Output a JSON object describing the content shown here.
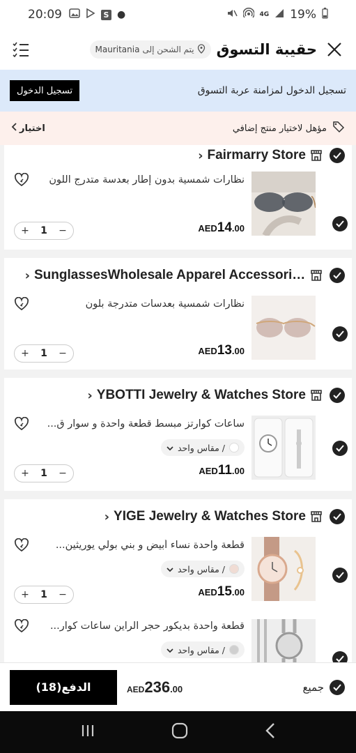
{
  "status_bar": {
    "time": "20:09",
    "battery": "19%",
    "s_box": "S",
    "network": "4G"
  },
  "header": {
    "title": "حقيبة التسوق",
    "ship_to_label": "يتم الشحن إلى",
    "country": "Mauritania"
  },
  "signin": {
    "text": "تسجيل الدخول لمزامنة عربة التسوق",
    "button": "تسجيل الدخول"
  },
  "promo": {
    "text": "مؤهل لاختيار منتج إضافي",
    "choose": "اختيار"
  },
  "stores": [
    {
      "name": "Fairmarry Store",
      "items": [
        {
          "title": "نظارات شمسية بدون إطار بعدسة متدرج اللون",
          "currency": "AED",
          "price_int": "14",
          "price_dec": ".00",
          "qty": "1",
          "variant": null
        }
      ]
    },
    {
      "name": "SunglassesWholesale Apparel Accessories ...",
      "items": [
        {
          "title": "نظارات شمسية بعدسات متدرجة بلون",
          "currency": "AED",
          "price_int": "13",
          "price_dec": ".00",
          "qty": "1",
          "variant": null
        }
      ]
    },
    {
      "name": "YBOTTI Jewelry & Watches Store",
      "items": [
        {
          "title": "ساعات كوارتز مبسط قطعة واحدة و سوار ق...",
          "currency": "AED",
          "price_int": "11",
          "price_dec": ".00",
          "qty": "1",
          "variant": "/ مقاس واحد"
        }
      ]
    },
    {
      "name": "YIGE Jewelry & Watches Store",
      "items": [
        {
          "title": "قطعة واحدة نساء أبيض و بني بولي يوريثين...",
          "currency": "AED",
          "price_int": "15",
          "price_dec": ".00",
          "qty": "1",
          "variant": "/ مقاس واحد"
        },
        {
          "title": "قطعة واحدة بديكور حجر الراين ساعات كوار...",
          "variant": "/ مقاس واحد"
        }
      ]
    }
  ],
  "checkout": {
    "all_label": "جميع",
    "currency": "AED",
    "total_int": "236",
    "total_dec": ".00",
    "pay_label": "الدفع(18)"
  },
  "colors": {
    "banner_bg": "#dce9fa",
    "promo_bg": "#fdf0ec",
    "button_bg": "#000000"
  }
}
